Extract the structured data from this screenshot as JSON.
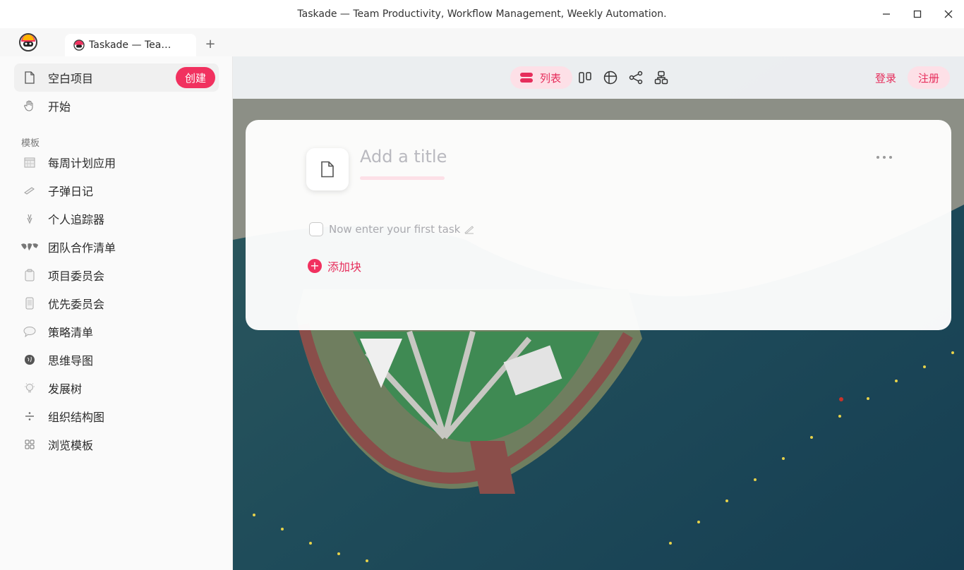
{
  "window": {
    "title": "Taskade — Team Productivity, Workflow Management, Weekly Automation.",
    "controls": {
      "minimize": "—",
      "maximize": "☐",
      "close": "✕"
    }
  },
  "browser": {
    "tab_label": "Taskade — Tea…",
    "new_tab": "+"
  },
  "sidebar": {
    "blank_project": {
      "label": "空白项目",
      "icon": "file-icon"
    },
    "create_label": "创建",
    "get_started": {
      "label": "开始",
      "icon": "hand-wave-icon"
    },
    "templates_header": "模板",
    "templates": [
      {
        "label": "每周计划应用",
        "icon": "calendar-icon"
      },
      {
        "label": "子弹日记",
        "icon": "pencil-icon"
      },
      {
        "label": "个人追踪器",
        "icon": "hands-icon"
      },
      {
        "label": "团队合作清单",
        "icon": "world-map-icon"
      },
      {
        "label": "项目委员会",
        "icon": "clipboard-icon"
      },
      {
        "label": "优先委员会",
        "icon": "phone-icon"
      },
      {
        "label": "策略清单",
        "icon": "speech-bubble-icon"
      },
      {
        "label": "思维导图",
        "icon": "brain-icon"
      },
      {
        "label": "发展树",
        "icon": "lightbulb-icon"
      },
      {
        "label": "组织结构图",
        "icon": "divide-icon"
      },
      {
        "label": "浏览模板",
        "icon": "grid-icon"
      }
    ]
  },
  "toolbar": {
    "active_view_label": "列表",
    "views": [
      "board-icon",
      "table-icon",
      "mindmap-icon",
      "orgchart-icon"
    ],
    "login_label": "登录",
    "signup_label": "注册"
  },
  "editor": {
    "title_placeholder": "Add a title",
    "task_placeholder": "Now enter your first task",
    "add_block_label": "添加块"
  },
  "colors": {
    "accent": "#f1315f",
    "accent_soft": "#fde0e7",
    "sidebar_bg": "#fafafa"
  }
}
